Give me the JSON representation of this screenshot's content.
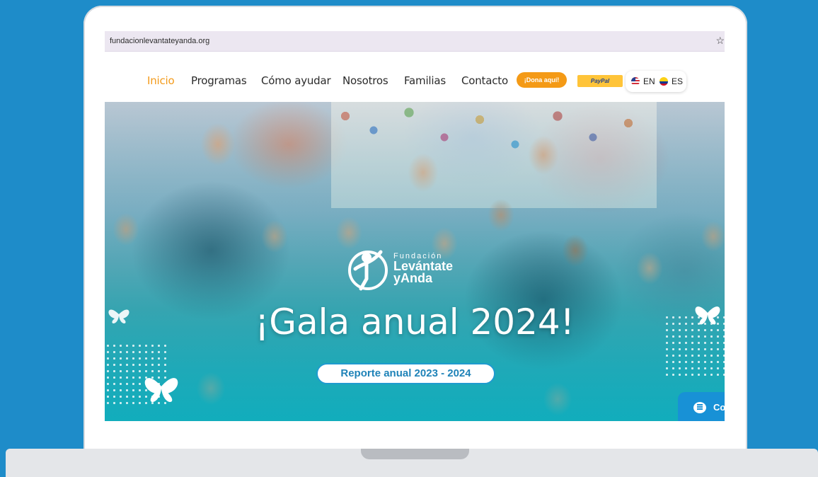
{
  "browser": {
    "url": "fundacionlevantateyanda.org",
    "bookmark_icon": "star-icon"
  },
  "nav": {
    "items": [
      {
        "label": "Inicio",
        "active": true
      },
      {
        "label": "Programas"
      },
      {
        "label": "Cómo ayudar"
      },
      {
        "label": "Nosotros"
      },
      {
        "label": "Familias"
      },
      {
        "label": "Contacto"
      }
    ],
    "donate_label": "¡Dona aquí!",
    "paypal_label": "PayPal",
    "lang_en": "EN",
    "lang_es": "ES"
  },
  "hero": {
    "logo_small": "Fundación",
    "logo_name_1": "Levántate",
    "logo_name_2": "yAnda",
    "title": "¡Gala anual 2024!",
    "report_button": "Reporte anual 2023 - 2024"
  },
  "chat": {
    "label": "Co"
  },
  "colors": {
    "background": "#1e8cc9",
    "accent_orange": "#f39a1a",
    "paypal_yellow": "#ffc439",
    "button_blue": "#1f83b8"
  }
}
